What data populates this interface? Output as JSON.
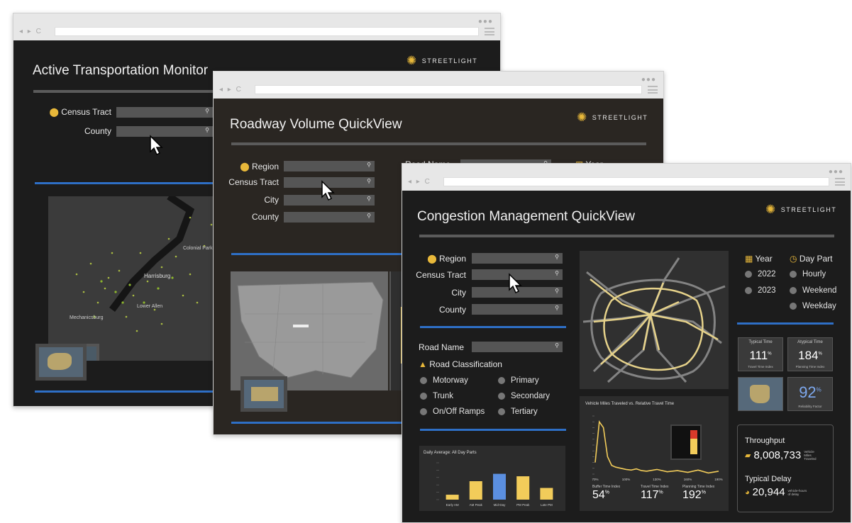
{
  "colors": {
    "accent_gold": "#e8b83a",
    "accent_blue": "#2e6fc6",
    "panel_bg": "#1c1c1c",
    "bar_yellow": "#f2cc5a",
    "bar_blue": "#5b8fe0"
  },
  "brand": {
    "logo_text": "STREETLIGHT"
  },
  "win1": {
    "title": "Active Transportation Monitor",
    "fields": [
      {
        "label": "Census Tract"
      },
      {
        "label": "County"
      }
    ],
    "map_labels": [
      "Harrisburg",
      "Mechanicsburg",
      "Lower Allen",
      "Colonial Park"
    ]
  },
  "win2": {
    "title": "Roadway Volume QuickView",
    "fields": [
      {
        "label": "Region"
      },
      {
        "label": "Census Tract"
      },
      {
        "label": "City"
      },
      {
        "label": "County"
      }
    ],
    "road_name_label": "Road Name",
    "year_label": "Year"
  },
  "win3": {
    "title": "Congestion Management QuickView",
    "fields": [
      {
        "label": "Region"
      },
      {
        "label": "Census Tract"
      },
      {
        "label": "City"
      },
      {
        "label": "County"
      }
    ],
    "road_name_label": "Road Name",
    "road_class_label": "Road Classification",
    "road_classes": [
      "Motorway",
      "Primary",
      "Trunk",
      "Secondary",
      "On/Off Ramps",
      "Tertiary"
    ],
    "year_label": "Year",
    "years": [
      "2022",
      "2023"
    ],
    "day_part_label": "Day Part",
    "day_parts": [
      "Hourly",
      "Weekend",
      "Weekday"
    ],
    "metrics": {
      "typical_time": {
        "title": "Typical Time",
        "value": "111",
        "unit": "%",
        "sub": "Travel Time Index"
      },
      "atypical_time": {
        "title": "Atypical Time",
        "value": "184",
        "unit": "%",
        "sub": "Planning Time Index"
      },
      "reliability": {
        "value": "92",
        "unit": "%",
        "sub": "Reliability Factor"
      }
    },
    "throughput": {
      "label": "Throughput",
      "value": "8,008,733",
      "unit": "Vehicle Miles Traveled"
    },
    "typical_delay": {
      "label": "Typical Delay",
      "value": "20,944",
      "unit": "vehicle-hours of delay"
    },
    "vmt_chart_title": "Vehicle Miles Traveled vs. Relative Travel Time",
    "vmt_stats": [
      {
        "label": "Buffer Time Index",
        "value": "54",
        "unit": "%"
      },
      {
        "label": "Travel Time Index",
        "value": "117",
        "unit": "%"
      },
      {
        "label": "Planning Time Index",
        "value": "192",
        "unit": "%"
      }
    ]
  },
  "chart_data": [
    {
      "type": "bar",
      "title": "Daily Average: All Day Parts",
      "categories": [
        "Early AM",
        "AM Peak",
        "Mid-Day",
        "PM Peak",
        "Late PM"
      ],
      "values": [
        8,
        30,
        42,
        38,
        19
      ],
      "highlight_index": 2,
      "ylim": [
        0,
        60
      ]
    },
    {
      "type": "line",
      "title": "Vehicle Miles Traveled vs. Relative Travel Time",
      "x": [
        0.7,
        0.74,
        0.78,
        0.82,
        0.86,
        0.9,
        0.95,
        1.0,
        1.05,
        1.1,
        1.15,
        1.2,
        1.3,
        1.4,
        1.5,
        1.6,
        1.7,
        1.8,
        1.9
      ],
      "y": [
        2,
        9,
        8,
        3,
        1.5,
        1.2,
        1,
        0.8,
        0.7,
        0.9,
        0.6,
        0.5,
        0.8,
        0.4,
        0.6,
        0.3,
        0.7,
        0.2,
        0.5
      ],
      "xticks": [
        "70%",
        "100%",
        "130%",
        "160%",
        "190%"
      ],
      "ylim": [
        0,
        10
      ]
    }
  ]
}
